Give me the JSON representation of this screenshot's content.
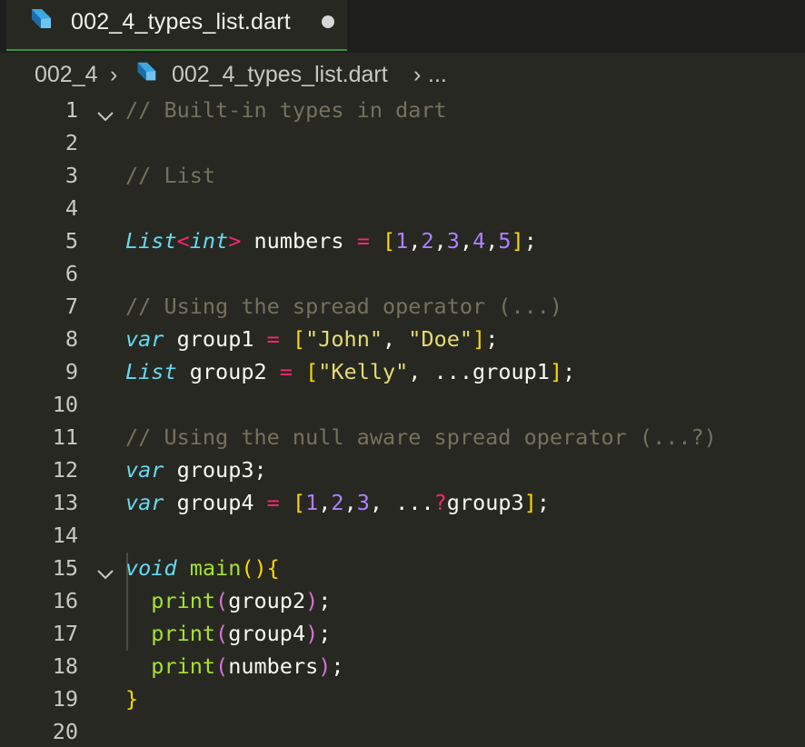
{
  "tab": {
    "title": "002_4_types_list.dart",
    "dirty": true
  },
  "breadcrumb": {
    "folder": "002_4",
    "file": "002_4_types_list.dart",
    "more": "..."
  },
  "colors": {
    "background": "#272822",
    "comment": "#75715e",
    "type": "#66d9ef",
    "operator": "#f92672",
    "number": "#ae81ff",
    "string": "#e6db74",
    "function": "#a6e22e",
    "bracket_gold": "#ffd700",
    "bracket_pink": "#da70d6"
  },
  "editor": {
    "lines": [
      {
        "n": "1",
        "fold": true,
        "tokens": [
          [
            "cm",
            "// Built-in types in dart"
          ]
        ]
      },
      {
        "n": "2",
        "tokens": []
      },
      {
        "n": "3",
        "tokens": [
          [
            "cm",
            "// List"
          ]
        ]
      },
      {
        "n": "4",
        "tokens": []
      },
      {
        "n": "5",
        "tokens": [
          [
            "ty",
            "List"
          ],
          [
            "op",
            "<"
          ],
          [
            "ty",
            "int"
          ],
          [
            "op",
            ">"
          ],
          [
            "",
            " numbers "
          ],
          [
            "op",
            "="
          ],
          [
            "",
            " "
          ],
          [
            "br1",
            "["
          ],
          [
            "num",
            "1"
          ],
          [
            "",
            ","
          ],
          [
            "num",
            "2"
          ],
          [
            "",
            ","
          ],
          [
            "num",
            "3"
          ],
          [
            "",
            ","
          ],
          [
            "num",
            "4"
          ],
          [
            "",
            ","
          ],
          [
            "num",
            "5"
          ],
          [
            "br1",
            "]"
          ],
          [
            "",
            ";"
          ]
        ]
      },
      {
        "n": "6",
        "tokens": []
      },
      {
        "n": "7",
        "tokens": [
          [
            "cm",
            "// Using the spread operator (...)"
          ]
        ]
      },
      {
        "n": "8",
        "tokens": [
          [
            "kw",
            "var"
          ],
          [
            "",
            " group1 "
          ],
          [
            "op",
            "="
          ],
          [
            "",
            " "
          ],
          [
            "br1",
            "["
          ],
          [
            "str",
            "\"John\""
          ],
          [
            "",
            ", "
          ],
          [
            "str",
            "\"Doe\""
          ],
          [
            "br1",
            "]"
          ],
          [
            "",
            ";"
          ]
        ]
      },
      {
        "n": "9",
        "tokens": [
          [
            "ty",
            "List"
          ],
          [
            "",
            " group2 "
          ],
          [
            "op",
            "="
          ],
          [
            "",
            " "
          ],
          [
            "br1",
            "["
          ],
          [
            "str",
            "\"Kelly\""
          ],
          [
            "",
            ", ...group1"
          ],
          [
            "br1",
            "]"
          ],
          [
            "",
            ";"
          ]
        ]
      },
      {
        "n": "10",
        "tokens": []
      },
      {
        "n": "11",
        "tokens": [
          [
            "cm",
            "// Using the null aware spread operator (...?)"
          ]
        ]
      },
      {
        "n": "12",
        "tokens": [
          [
            "kw",
            "var"
          ],
          [
            "",
            " group3;"
          ]
        ]
      },
      {
        "n": "13",
        "tokens": [
          [
            "kw",
            "var"
          ],
          [
            "",
            " group4 "
          ],
          [
            "op",
            "="
          ],
          [
            "",
            " "
          ],
          [
            "br1",
            "["
          ],
          [
            "num",
            "1"
          ],
          [
            "",
            ","
          ],
          [
            "num",
            "2"
          ],
          [
            "",
            ","
          ],
          [
            "num",
            "3"
          ],
          [
            "",
            ", ..."
          ],
          [
            "op",
            "?"
          ],
          [
            "",
            "group3"
          ],
          [
            "br1",
            "]"
          ],
          [
            "",
            ";"
          ]
        ]
      },
      {
        "n": "14",
        "tokens": []
      },
      {
        "n": "15",
        "fold": true,
        "tokens": [
          [
            "kw",
            "void"
          ],
          [
            "",
            " "
          ],
          [
            "fn",
            "main"
          ],
          [
            "br1",
            "()"
          ],
          [
            "br1",
            "{"
          ]
        ]
      },
      {
        "n": "16",
        "tokens": [
          [
            "",
            "  "
          ],
          [
            "fn",
            "print"
          ],
          [
            "br2",
            "("
          ],
          [
            "",
            "group2"
          ],
          [
            "br2",
            ")"
          ],
          [
            "",
            ";"
          ]
        ]
      },
      {
        "n": "17",
        "tokens": [
          [
            "",
            "  "
          ],
          [
            "fn",
            "print"
          ],
          [
            "br2",
            "("
          ],
          [
            "",
            "group4"
          ],
          [
            "br2",
            ")"
          ],
          [
            "",
            ";"
          ]
        ]
      },
      {
        "n": "18",
        "tokens": [
          [
            "",
            "  "
          ],
          [
            "fn",
            "print"
          ],
          [
            "br2",
            "("
          ],
          [
            "",
            "numbers"
          ],
          [
            "br2",
            ")"
          ],
          [
            "",
            ";"
          ]
        ]
      },
      {
        "n": "19",
        "tokens": [
          [
            "br1",
            "}"
          ]
        ]
      },
      {
        "n": "20",
        "tokens": []
      }
    ]
  }
}
